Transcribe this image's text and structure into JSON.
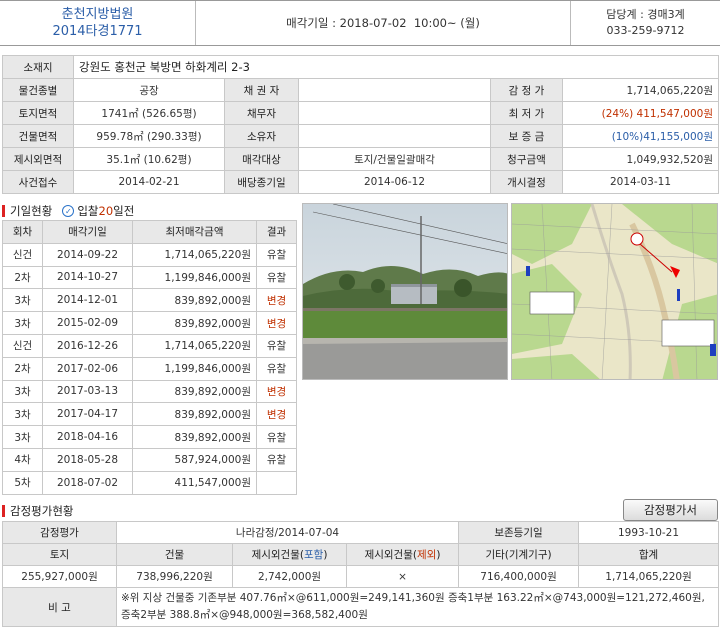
{
  "header": {
    "court": "춘천지방법원",
    "case_no": "2014타경1771",
    "auction_date": "매각기일 : 2018-07-02  10:00~ (월)",
    "dept": "담당계 : 경매3계",
    "phone": "033-259-9712"
  },
  "info": {
    "location_label": "소재지",
    "location": "강원도 홍천군 북방면 하화계리 2-3",
    "type_label": "물건종별",
    "type": "공장",
    "creditor_label": "채 권 자",
    "creditor": "",
    "appraisal_label": "감 정 가",
    "appraisal": "1,714,065,220원",
    "land_label": "토지면적",
    "land": "1741㎡ (526.65평)",
    "debtor_label": "채무자",
    "debtor": "",
    "min_label": "최 저 가",
    "min_pct": "(24%)",
    "min_value": "411,547,000원",
    "building_label": "건물면적",
    "building": "959.78㎡ (290.33평)",
    "owner_label": "소유자",
    "owner": "",
    "deposit_label": "보 증 금",
    "deposit": "(10%)41,155,000원",
    "excluded_label": "제시외면적",
    "excluded": "35.1㎡ (10.62평)",
    "target_label": "매각대상",
    "target": "토지/건물일괄매각",
    "claim_label": "청구금액",
    "claim": "1,049,932,520원",
    "received_label": "사건접수",
    "received": "2014-02-21",
    "deadline_label": "배당종기일",
    "deadline": "2014-06-12",
    "start_label": "개시결정",
    "start": "2014-03-11"
  },
  "history": {
    "title": "기일현황",
    "remaining_pre": "입찰",
    "remaining_days": "20",
    "remaining_post": "일전",
    "headers": [
      "회차",
      "매각기일",
      "최저매각금액",
      "결과"
    ],
    "rows": [
      {
        "round": "신건",
        "date": "2014-09-22",
        "price": "1,714,065,220원",
        "result": "유찰",
        "kind": "ok"
      },
      {
        "round": "2차",
        "date": "2014-10-27",
        "price": "1,199,846,000원",
        "result": "유찰",
        "kind": "ok"
      },
      {
        "round": "3차",
        "date": "2014-12-01",
        "price": "839,892,000원",
        "result": "변경",
        "kind": "chg"
      },
      {
        "round": "3차",
        "date": "2015-02-09",
        "price": "839,892,000원",
        "result": "변경",
        "kind": "chg"
      },
      {
        "round": "신건",
        "date": "2016-12-26",
        "price": "1,714,065,220원",
        "result": "유찰",
        "kind": "ok"
      },
      {
        "round": "2차",
        "date": "2017-02-06",
        "price": "1,199,846,000원",
        "result": "유찰",
        "kind": "ok"
      },
      {
        "round": "3차",
        "date": "2017-03-13",
        "price": "839,892,000원",
        "result": "변경",
        "kind": "chg"
      },
      {
        "round": "3차",
        "date": "2017-04-17",
        "price": "839,892,000원",
        "result": "변경",
        "kind": "chg"
      },
      {
        "round": "3차",
        "date": "2018-04-16",
        "price": "839,892,000원",
        "result": "유찰",
        "kind": "ok"
      },
      {
        "round": "4차",
        "date": "2018-05-28",
        "price": "587,924,000원",
        "result": "유찰",
        "kind": "ok"
      },
      {
        "round": "5차",
        "date": "2018-07-02",
        "price": "411,547,000원",
        "result": "",
        "kind": "ok"
      }
    ]
  },
  "appraisal_section": {
    "title": "감정평가현황",
    "button": "감정평가서",
    "agency_label": "감정평가",
    "agency": "나라감정/2014-07-04",
    "preserve_label": "보존등기일",
    "preserve": "1993-10-21",
    "col_land": "토지",
    "col_building": "건물",
    "col_inc_pre": "제시외건물(",
    "col_inc_mid": "포함",
    "col_inc_post": ")",
    "col_exc_pre": "제시외건물(",
    "col_exc_mid": "제외",
    "col_exc_post": ")",
    "col_other": "기타(기계기구)",
    "col_total": "합계",
    "v_land": "255,927,000원",
    "v_building": "738,996,220원",
    "v_inc": "2,742,000원",
    "v_exc": "×",
    "v_other": "716,400,000원",
    "v_total": "1,714,065,220원",
    "note_label": "비 고",
    "note": "※위 지상 건물중 기존부분 407.76㎡×@611,000원=249,141,360원 증축1부분 163.22㎡×@743,000원=121,272,460원, 증축2부분 388.8㎡×@948,000원=368,582,400원"
  },
  "colors": {
    "court_blue": "#2b5ea8",
    "min_red": "#c03000",
    "changed": "#c03000",
    "label_bg": "#e8e8e8"
  }
}
